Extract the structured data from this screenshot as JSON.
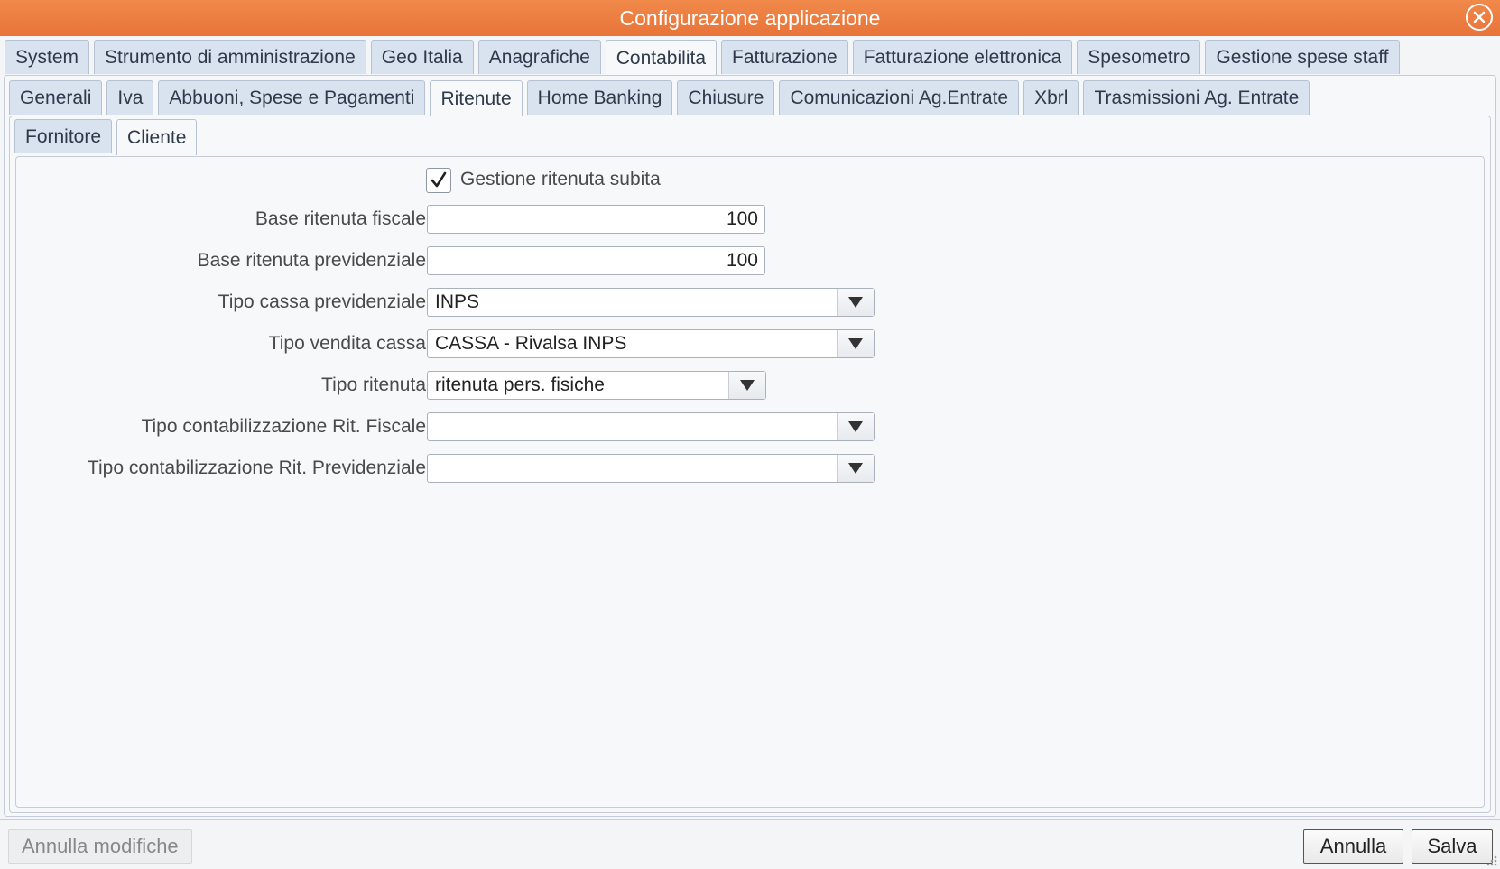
{
  "window": {
    "title": "Configurazione applicazione"
  },
  "top_tabs": [
    {
      "label": "System",
      "active": false
    },
    {
      "label": "Strumento di amministrazione",
      "active": false
    },
    {
      "label": "Geo Italia",
      "active": false
    },
    {
      "label": "Anagrafiche",
      "active": false
    },
    {
      "label": "Contabilita",
      "active": true
    },
    {
      "label": "Fatturazione",
      "active": false
    },
    {
      "label": "Fatturazione elettronica",
      "active": false
    },
    {
      "label": "Spesometro",
      "active": false
    },
    {
      "label": "Gestione spese staff",
      "active": false
    }
  ],
  "sub_tabs": [
    {
      "label": "Generali",
      "active": false
    },
    {
      "label": "Iva",
      "active": false
    },
    {
      "label": "Abbuoni, Spese e Pagamenti",
      "active": false
    },
    {
      "label": "Ritenute",
      "active": true
    },
    {
      "label": "Home Banking",
      "active": false
    },
    {
      "label": "Chiusure",
      "active": false
    },
    {
      "label": "Comunicazioni Ag.Entrate",
      "active": false
    },
    {
      "label": "Xbrl",
      "active": false
    },
    {
      "label": "Trasmissioni Ag. Entrate",
      "active": false
    }
  ],
  "inner_tabs": [
    {
      "label": "Fornitore",
      "active": false
    },
    {
      "label": "Cliente",
      "active": true
    }
  ],
  "form": {
    "gestione_ritenuta": {
      "label": "Gestione ritenuta subita",
      "checked": true
    },
    "base_fiscale": {
      "label": "Base ritenuta fiscale",
      "value": "100"
    },
    "base_previdenziale": {
      "label": "Base ritenuta previdenziale",
      "value": "100"
    },
    "tipo_cassa": {
      "label": "Tipo cassa previdenziale",
      "value": "INPS"
    },
    "tipo_vendita": {
      "label": "Tipo vendita cassa",
      "value": "CASSA - Rivalsa INPS"
    },
    "tipo_ritenuta": {
      "label": "Tipo ritenuta",
      "value": "ritenuta pers. fisiche"
    },
    "contab_fiscale": {
      "label": "Tipo contabilizzazione Rit. Fiscale",
      "value": ""
    },
    "contab_previdenziale": {
      "label": "Tipo contabilizzazione Rit. Previdenziale",
      "value": ""
    }
  },
  "footer": {
    "discard_label": "Annulla modifiche",
    "cancel_label": "Annulla",
    "save_label": "Salva"
  },
  "icons": {
    "close": "close-circle-icon",
    "dropdown": "triangle-down-icon",
    "check": "checkmark-icon",
    "resize": "resize-grip-icon"
  },
  "colors": {
    "titlebar": "#e8743a",
    "tab_inactive": "#d9e2ef",
    "tab_active": "#f7f8fa"
  }
}
